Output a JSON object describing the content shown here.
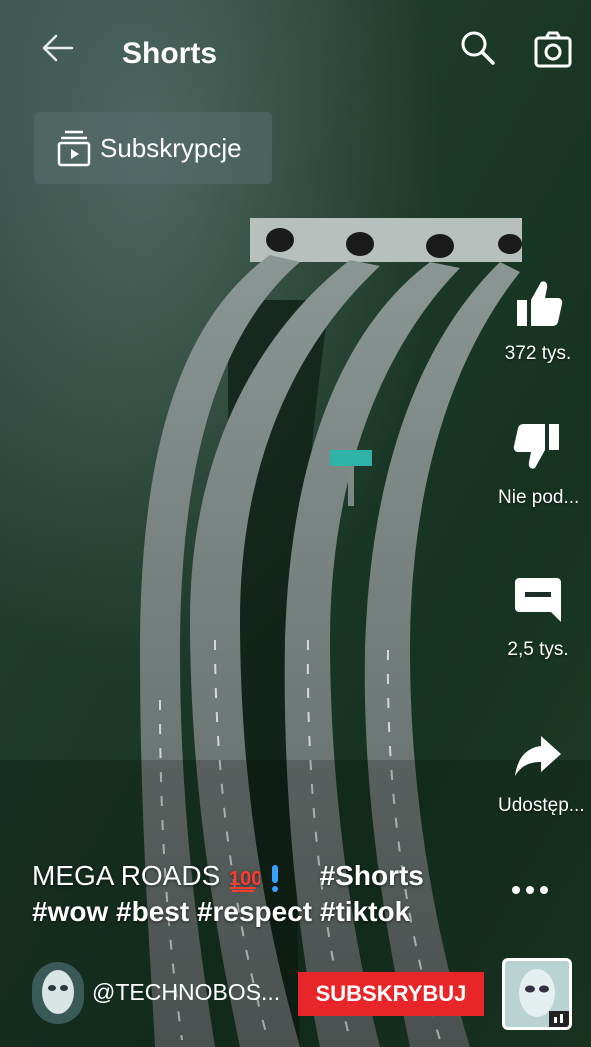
{
  "header": {
    "title": "Shorts"
  },
  "subscriptions": {
    "label": "Subskrypcje"
  },
  "actions": {
    "like_count": "372 tys.",
    "dislike_label": "Nie pod...",
    "comments_count": "2,5 tys.",
    "share_label": "Udostęp..."
  },
  "caption": {
    "line1_text": "MEGA ROADS",
    "line1_hashtag": "#Shorts",
    "line2": "#wow #best #respect #tiktok"
  },
  "channel": {
    "handle": "@TECHNOBOS...",
    "subscribe_label": "SUBSKRYBUJ"
  },
  "icons": {
    "back": "arrow-left-icon",
    "search": "search-icon",
    "camera": "camera-icon",
    "subscriptions": "subscriptions-icon",
    "like": "thumbs-up-icon",
    "dislike": "thumbs-down-icon",
    "comments": "comment-icon",
    "share": "share-icon",
    "more": "more-dots-icon"
  },
  "colors": {
    "subscribe": "#e8262a",
    "text": "#ffffff"
  }
}
